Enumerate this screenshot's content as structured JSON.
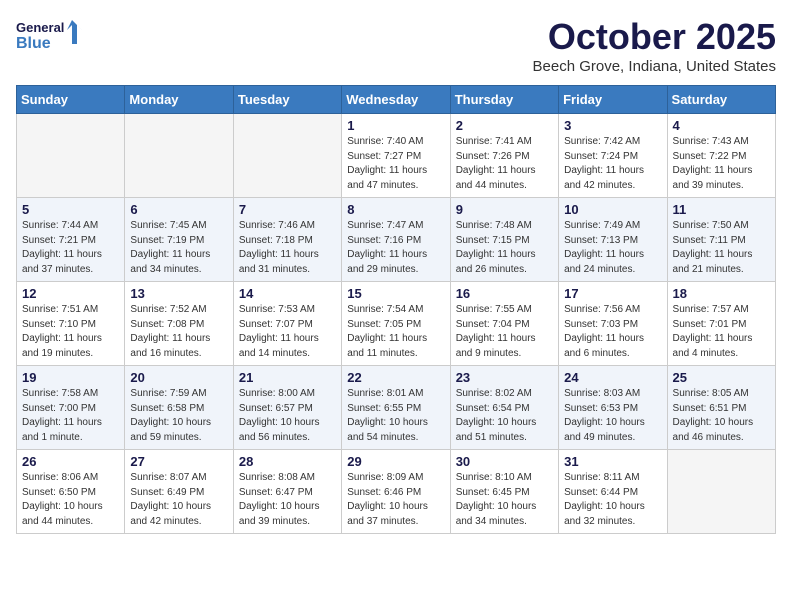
{
  "header": {
    "logo_line1": "General",
    "logo_line2": "Blue",
    "month": "October 2025",
    "location": "Beech Grove, Indiana, United States"
  },
  "weekdays": [
    "Sunday",
    "Monday",
    "Tuesday",
    "Wednesday",
    "Thursday",
    "Friday",
    "Saturday"
  ],
  "weeks": [
    [
      {
        "day": "",
        "info": ""
      },
      {
        "day": "",
        "info": ""
      },
      {
        "day": "",
        "info": ""
      },
      {
        "day": "1",
        "info": "Sunrise: 7:40 AM\nSunset: 7:27 PM\nDaylight: 11 hours\nand 47 minutes."
      },
      {
        "day": "2",
        "info": "Sunrise: 7:41 AM\nSunset: 7:26 PM\nDaylight: 11 hours\nand 44 minutes."
      },
      {
        "day": "3",
        "info": "Sunrise: 7:42 AM\nSunset: 7:24 PM\nDaylight: 11 hours\nand 42 minutes."
      },
      {
        "day": "4",
        "info": "Sunrise: 7:43 AM\nSunset: 7:22 PM\nDaylight: 11 hours\nand 39 minutes."
      }
    ],
    [
      {
        "day": "5",
        "info": "Sunrise: 7:44 AM\nSunset: 7:21 PM\nDaylight: 11 hours\nand 37 minutes."
      },
      {
        "day": "6",
        "info": "Sunrise: 7:45 AM\nSunset: 7:19 PM\nDaylight: 11 hours\nand 34 minutes."
      },
      {
        "day": "7",
        "info": "Sunrise: 7:46 AM\nSunset: 7:18 PM\nDaylight: 11 hours\nand 31 minutes."
      },
      {
        "day": "8",
        "info": "Sunrise: 7:47 AM\nSunset: 7:16 PM\nDaylight: 11 hours\nand 29 minutes."
      },
      {
        "day": "9",
        "info": "Sunrise: 7:48 AM\nSunset: 7:15 PM\nDaylight: 11 hours\nand 26 minutes."
      },
      {
        "day": "10",
        "info": "Sunrise: 7:49 AM\nSunset: 7:13 PM\nDaylight: 11 hours\nand 24 minutes."
      },
      {
        "day": "11",
        "info": "Sunrise: 7:50 AM\nSunset: 7:11 PM\nDaylight: 11 hours\nand 21 minutes."
      }
    ],
    [
      {
        "day": "12",
        "info": "Sunrise: 7:51 AM\nSunset: 7:10 PM\nDaylight: 11 hours\nand 19 minutes."
      },
      {
        "day": "13",
        "info": "Sunrise: 7:52 AM\nSunset: 7:08 PM\nDaylight: 11 hours\nand 16 minutes."
      },
      {
        "day": "14",
        "info": "Sunrise: 7:53 AM\nSunset: 7:07 PM\nDaylight: 11 hours\nand 14 minutes."
      },
      {
        "day": "15",
        "info": "Sunrise: 7:54 AM\nSunset: 7:05 PM\nDaylight: 11 hours\nand 11 minutes."
      },
      {
        "day": "16",
        "info": "Sunrise: 7:55 AM\nSunset: 7:04 PM\nDaylight: 11 hours\nand 9 minutes."
      },
      {
        "day": "17",
        "info": "Sunrise: 7:56 AM\nSunset: 7:03 PM\nDaylight: 11 hours\nand 6 minutes."
      },
      {
        "day": "18",
        "info": "Sunrise: 7:57 AM\nSunset: 7:01 PM\nDaylight: 11 hours\nand 4 minutes."
      }
    ],
    [
      {
        "day": "19",
        "info": "Sunrise: 7:58 AM\nSunset: 7:00 PM\nDaylight: 11 hours\nand 1 minute."
      },
      {
        "day": "20",
        "info": "Sunrise: 7:59 AM\nSunset: 6:58 PM\nDaylight: 10 hours\nand 59 minutes."
      },
      {
        "day": "21",
        "info": "Sunrise: 8:00 AM\nSunset: 6:57 PM\nDaylight: 10 hours\nand 56 minutes."
      },
      {
        "day": "22",
        "info": "Sunrise: 8:01 AM\nSunset: 6:55 PM\nDaylight: 10 hours\nand 54 minutes."
      },
      {
        "day": "23",
        "info": "Sunrise: 8:02 AM\nSunset: 6:54 PM\nDaylight: 10 hours\nand 51 minutes."
      },
      {
        "day": "24",
        "info": "Sunrise: 8:03 AM\nSunset: 6:53 PM\nDaylight: 10 hours\nand 49 minutes."
      },
      {
        "day": "25",
        "info": "Sunrise: 8:05 AM\nSunset: 6:51 PM\nDaylight: 10 hours\nand 46 minutes."
      }
    ],
    [
      {
        "day": "26",
        "info": "Sunrise: 8:06 AM\nSunset: 6:50 PM\nDaylight: 10 hours\nand 44 minutes."
      },
      {
        "day": "27",
        "info": "Sunrise: 8:07 AM\nSunset: 6:49 PM\nDaylight: 10 hours\nand 42 minutes."
      },
      {
        "day": "28",
        "info": "Sunrise: 8:08 AM\nSunset: 6:47 PM\nDaylight: 10 hours\nand 39 minutes."
      },
      {
        "day": "29",
        "info": "Sunrise: 8:09 AM\nSunset: 6:46 PM\nDaylight: 10 hours\nand 37 minutes."
      },
      {
        "day": "30",
        "info": "Sunrise: 8:10 AM\nSunset: 6:45 PM\nDaylight: 10 hours\nand 34 minutes."
      },
      {
        "day": "31",
        "info": "Sunrise: 8:11 AM\nSunset: 6:44 PM\nDaylight: 10 hours\nand 32 minutes."
      },
      {
        "day": "",
        "info": ""
      }
    ]
  ]
}
